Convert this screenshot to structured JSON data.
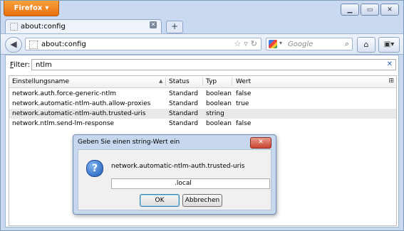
{
  "browser": {
    "menu_button": "Firefox"
  },
  "tab": {
    "title": "about:config"
  },
  "nav": {
    "url": "about:config",
    "search_placeholder": "Google"
  },
  "filter": {
    "label_prefix": "F",
    "label_rest": "ilter:",
    "value": "ntlm"
  },
  "table": {
    "columns": [
      "Einstellungsname",
      "Status",
      "Typ",
      "Wert"
    ],
    "rows": [
      {
        "name": "network.auth.force-generic-ntlm",
        "status": "Standard",
        "type": "boolean",
        "value": "false"
      },
      {
        "name": "network.automatic-ntlm-auth.allow-proxies",
        "status": "Standard",
        "type": "boolean",
        "value": "true"
      },
      {
        "name": "network.automatic-ntlm-auth.trusted-uris",
        "status": "Standard",
        "type": "string",
        "value": ""
      },
      {
        "name": "network.ntlm.send-lm-response",
        "status": "Standard",
        "type": "boolean",
        "value": "false"
      }
    ]
  },
  "dialog": {
    "title": "Geben Sie einen string-Wert ein",
    "message": "network.automatic-ntlm-auth.trusted-uris",
    "input_value": ".local",
    "ok_label": "OK",
    "cancel_label": "Abbrechen"
  }
}
